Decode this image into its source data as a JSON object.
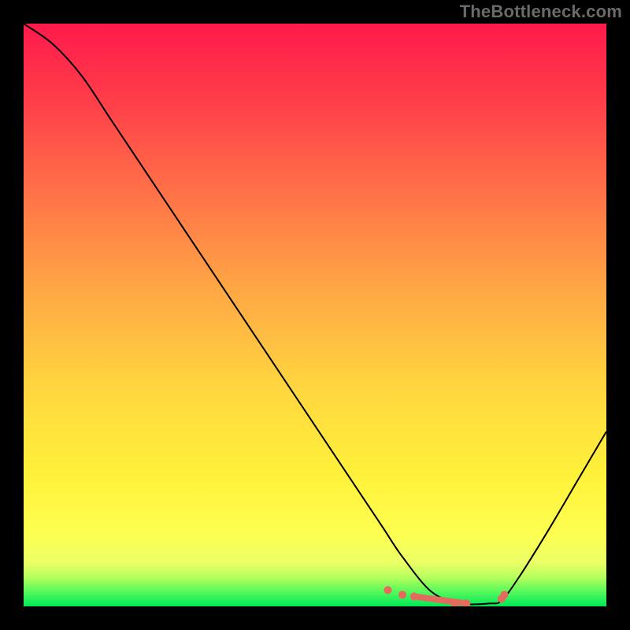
{
  "watermark": "TheBottleneck.com",
  "chart_data": {
    "type": "line",
    "title": "",
    "xlabel": "",
    "ylabel": "",
    "xlim": [
      0,
      100
    ],
    "ylim": [
      0,
      100
    ],
    "x": [
      0,
      5,
      10,
      15,
      20,
      25,
      30,
      35,
      40,
      45,
      50,
      55,
      60,
      62,
      65,
      70,
      75,
      80,
      82,
      85,
      90,
      95,
      100
    ],
    "values": [
      100,
      96.5,
      91,
      83.5,
      76,
      68.5,
      61,
      53.5,
      46,
      38.5,
      31,
      23.5,
      16,
      13,
      8.5,
      2.5,
      0.5,
      0.5,
      1,
      5,
      13,
      21.5,
      30
    ],
    "markers": {
      "x": [
        62.5,
        65,
        67,
        74,
        76,
        82,
        82.5
      ],
      "y": [
        2.8,
        2.0,
        1.7,
        0.5,
        0.5,
        1.3,
        2.0
      ]
    },
    "series_color": "#000000",
    "marker_color": "#e46a5e"
  }
}
